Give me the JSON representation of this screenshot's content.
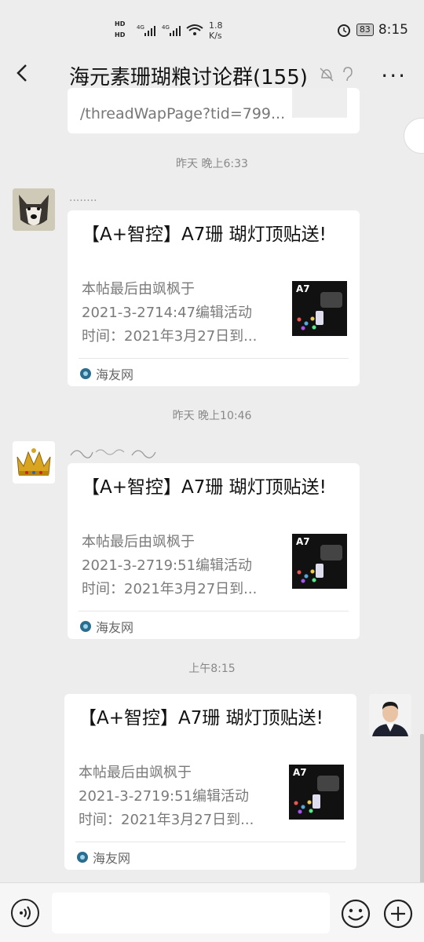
{
  "status_bar": {
    "hd1": "HD",
    "hd2": "HD",
    "net1": "4G",
    "net2": "4G",
    "speed": "1.8",
    "speed_unit": "K/s",
    "battery": "83",
    "time": "8:15"
  },
  "header": {
    "title": "海元素珊瑚粮讨论群(155)",
    "back_icon": "chevron-left-icon",
    "more_label": "···"
  },
  "top_card": {
    "url_fragment": "/threadWapPage?tid=799..."
  },
  "messages": [
    {
      "timestamp": "昨天 晚上6:33",
      "nickname": "........",
      "card_title": "【A+智控】A7珊 瑚灯顶贴送!",
      "desc_line1": "本帖最后由飒枫于",
      "desc_line2": "2021-3-2714:47编辑活动",
      "desc_line3": "时间：2021年3月27日到...",
      "thumb_label": "A7",
      "source": "海友网"
    },
    {
      "timestamp": "昨天 晚上10:46",
      "nickname": "",
      "card_title": "【A+智控】A7珊 瑚灯顶贴送!",
      "desc_line1": "本帖最后由飒枫于",
      "desc_line2": "2021-3-2719:51编辑活动",
      "desc_line3": "时间：2021年3月27日到...",
      "thumb_label": "A7",
      "source": "海友网"
    },
    {
      "timestamp": "上午8:15",
      "card_title": "【A+智控】A7珊 瑚灯顶贴送!",
      "desc_line1": "本帖最后由飒枫于",
      "desc_line2": "2021-3-2719:51编辑活动",
      "desc_line3": "时间：2021年3月27日到...",
      "thumb_label": "A7",
      "source": "海友网"
    }
  ],
  "colors": {
    "background": "#ededed",
    "card": "#ffffff",
    "muted_text": "#7a7a7a"
  }
}
